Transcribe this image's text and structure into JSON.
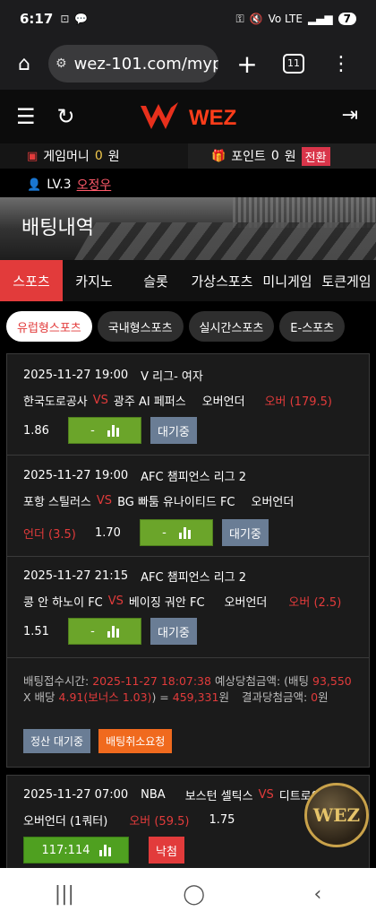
{
  "status": {
    "time": "6:17",
    "icons": [
      "⊡",
      "💬"
    ],
    "net": "Vo LTE",
    "battery": "7"
  },
  "browser": {
    "url": "wez-101.com/myp",
    "tab_count": "11"
  },
  "header": {
    "logo_text": "WEZ"
  },
  "account": {
    "game_money_label": "게임머니",
    "game_money_value": "0",
    "won1": "원",
    "point_label": "포인트",
    "point_value": "0",
    "won2": "원",
    "convert": "전환",
    "level": "LV.3",
    "username": "오정우"
  },
  "banner": {
    "title": "배팅내역"
  },
  "categories": [
    "스포츠",
    "카지노",
    "슬롯",
    "가상스포츠",
    "미니게임",
    "토큰게임"
  ],
  "subtabs": [
    "유럽형스포츠",
    "국내형스포츠",
    "실시간스포츠",
    "E-스포츠"
  ],
  "bets": [
    {
      "date": "2025-11-27 19:00",
      "league": "V 리그- 여자",
      "home": "한국도로공사",
      "vs": "VS",
      "away": "광주 AI 페퍼스",
      "market": "오버언더",
      "pick": "오버 (179.5)",
      "odds": "1.86",
      "result": "-",
      "status": "대기중"
    },
    {
      "date": "2025-11-27 19:00",
      "league": "AFC 챔피언스 리그 2",
      "home": "포항 스틸러스",
      "vs": "VS",
      "away": "BG 빠툼 유나이티드 FC",
      "market": "오버언더",
      "pick": "언더 (3.5)",
      "odds": "1.70",
      "result": "-",
      "status": "대기중"
    },
    {
      "date": "2025-11-27 21:15",
      "league": "AFC 챔피언스 리그 2",
      "home": "콩 안 하노이 FC",
      "vs": "VS",
      "away": "베이징 궈안 FC",
      "market": "오버언더",
      "pick": "오버 (2.5)",
      "odds": "1.51",
      "result": "-",
      "status": "대기중"
    }
  ],
  "summary": {
    "accept_label": "배팅접수시간:",
    "accept_time": "2025-11-27 18:07:38",
    "expected_label": "예상당첨금액: (배팅",
    "stake": "93,550",
    "x_odds": "X 배당",
    "total_odds": "4.91(보너스 1.03)",
    "equals": ") =",
    "expected": "459,331",
    "won": "원",
    "result_label": "결과당첨금액:",
    "result": "0",
    "won_b": "원",
    "settle_button": "정산 대기중",
    "cancel_button": "배팅취소요청"
  },
  "bet2": {
    "date": "2025-11-27 07:00",
    "league": "NBA",
    "home": "보스턴 셀틱스",
    "vs": "VS",
    "away": "디트로이트",
    "market": "오버언더 (1쿼터)",
    "pick": "오버 (59.5)",
    "odds": "1.75",
    "score": "117:114",
    "status": "낙첨"
  },
  "badge": {
    "text": "WEZ"
  },
  "nav": {
    "recent": "|||",
    "home": "◯",
    "back": "‹"
  }
}
